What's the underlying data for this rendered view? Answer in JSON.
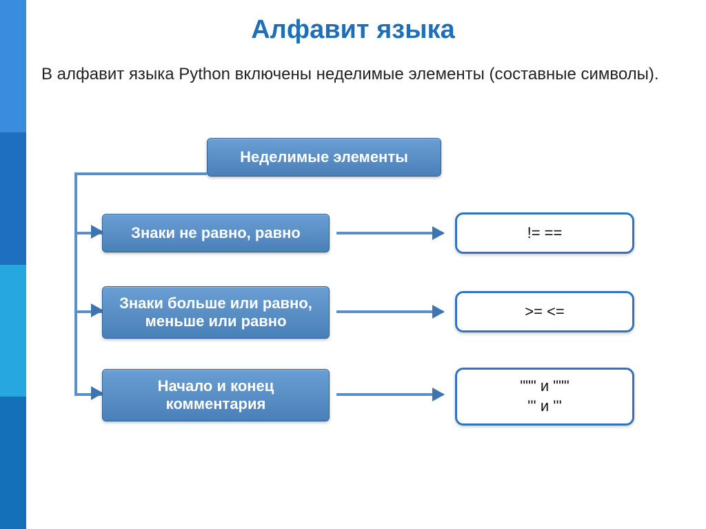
{
  "title": "Алфавит языка",
  "intro": "В алфавит языка Python включены неделимые элементы (составные символы).",
  "root": {
    "label": "Неделимые элементы"
  },
  "rows": [
    {
      "label": "Знаки не равно, равно",
      "example": "!=   =="
    },
    {
      "label": "Знаки больше или равно,\nменьше или равно",
      "example": ">=  <="
    },
    {
      "label": "Начало и конец\nкомментария",
      "example": "\"\"\" и \"\"\"\n''' и '''"
    }
  ]
}
